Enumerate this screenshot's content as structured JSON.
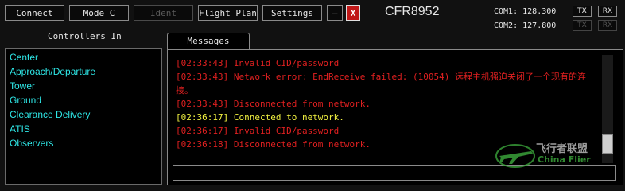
{
  "toolbar": {
    "connect": "Connect",
    "mode": "Mode C",
    "ident": "Ident",
    "flight_plan": "Flight Plan",
    "settings": "Settings",
    "minimize": "–",
    "close": "X"
  },
  "callsign": "CFR8952",
  "com": [
    {
      "label": "COM1:",
      "freq": "128.300",
      "tx": "TX",
      "rx": "RX"
    },
    {
      "label": "COM2:",
      "freq": "127.800",
      "tx": "TX",
      "rx": "RX"
    }
  ],
  "controllers": {
    "header": "Controllers In",
    "items": [
      "Center",
      "Approach/Departure",
      "Tower",
      "Ground",
      "Clearance Delivery",
      "ATIS",
      "Observers"
    ]
  },
  "messages": {
    "tab_label": "Messages",
    "lines": [
      {
        "text": "[02:33:43] Invalid CID/password",
        "color": "#e02020"
      },
      {
        "text": "[02:33:43] Network error: EndReceive failed: (10054) 远程主机强迫关闭了一个现有的连接。",
        "color": "#e02020"
      },
      {
        "text": "[02:33:43] Disconnected from network.",
        "color": "#e02020"
      },
      {
        "text": "[02:36:17] Connected to network.",
        "color": "#f0f040"
      },
      {
        "text": "[02:36:17] Invalid CID/password",
        "color": "#e02020"
      },
      {
        "text": "[02:36:18] Disconnected from network.",
        "color": "#e02020"
      }
    ],
    "input_value": ""
  },
  "watermark": {
    "line1": "飞行者联盟",
    "line2": "China Flier"
  },
  "colors": {
    "error": "#e02020",
    "info": "#f0f040",
    "controller": "#2ee6e6",
    "close_button": "#c01818"
  }
}
